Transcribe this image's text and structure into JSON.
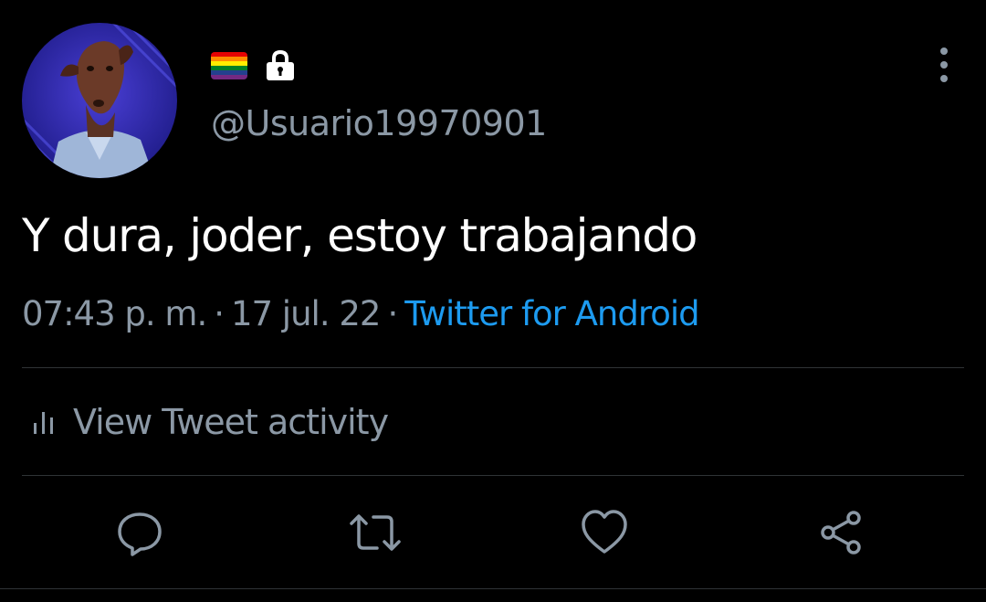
{
  "tweet": {
    "author": {
      "display_name_icons": [
        "rainbow-flag-icon",
        "lock-icon"
      ],
      "handle": "@Usuario19970901",
      "avatar_description": "avatar"
    },
    "text": "Y dura, joder, estoy trabajando",
    "time": "07:43 p. m.",
    "separator": "·",
    "date": "17 jul. 22",
    "source": "Twitter for Android"
  },
  "activity": {
    "icon": "bar-chart-icon",
    "label": "View Tweet activity"
  },
  "actions": [
    {
      "name": "reply",
      "icon": "reply-bubble-icon"
    },
    {
      "name": "retweet",
      "icon": "retweet-icon"
    },
    {
      "name": "like",
      "icon": "heart-icon"
    },
    {
      "name": "share",
      "icon": "share-icon"
    }
  ],
  "colors": {
    "background": "#000000",
    "text_primary": "#ffffff",
    "text_secondary": "#8b98a5",
    "link": "#1d9bf0",
    "divider": "#2f3336",
    "flag": [
      "#e40303",
      "#ff8c00",
      "#ffed00",
      "#008026",
      "#24408e",
      "#732982"
    ]
  }
}
